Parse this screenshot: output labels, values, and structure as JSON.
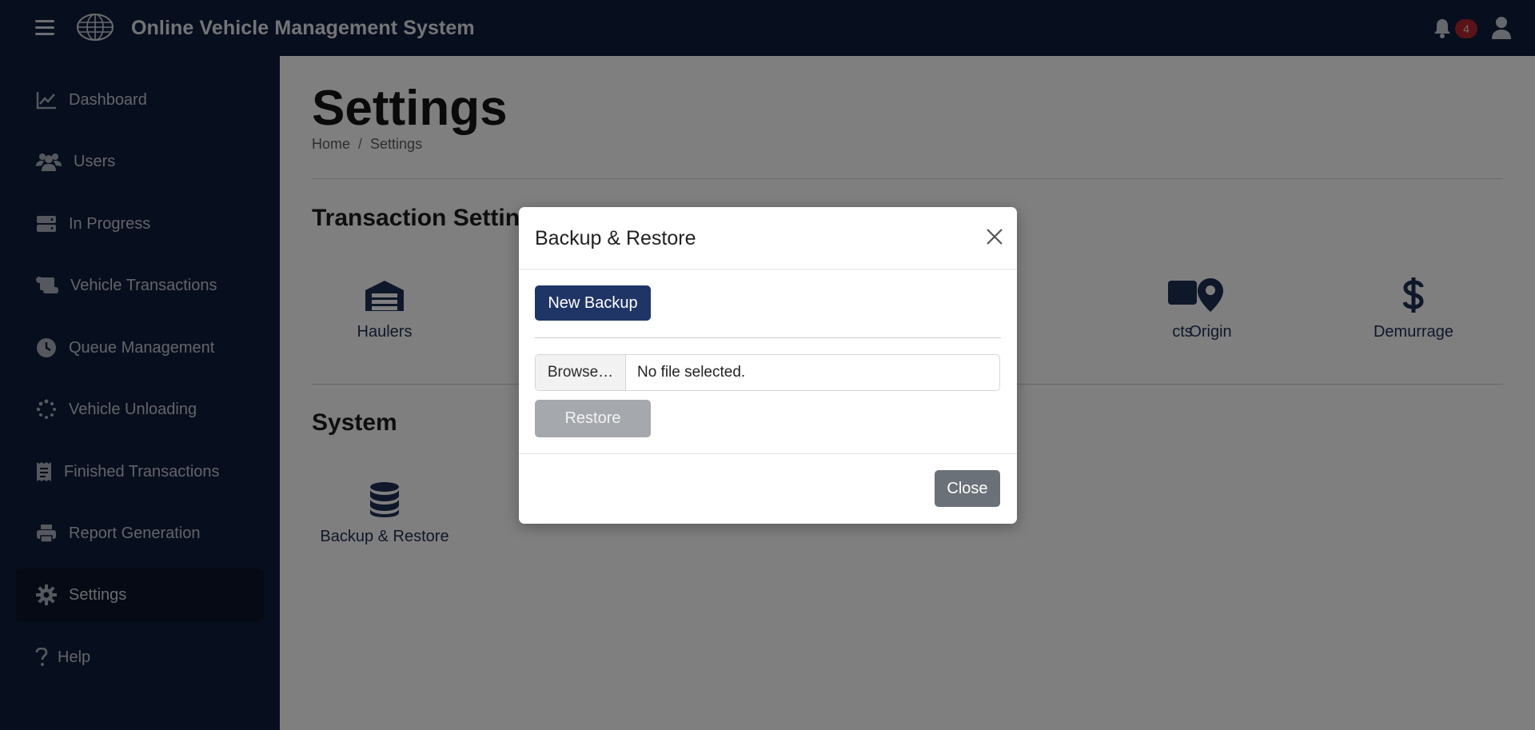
{
  "app": {
    "title": "Online Vehicle Management System",
    "notification_count": "4"
  },
  "sidebar": {
    "items": [
      {
        "label": "Dashboard",
        "icon": "chart-line-icon"
      },
      {
        "label": "Users",
        "icon": "users-icon"
      },
      {
        "label": "In Progress",
        "icon": "server-icon"
      },
      {
        "label": "Vehicle Transactions",
        "icon": "scroll-icon"
      },
      {
        "label": "Queue Management",
        "icon": "clock-icon"
      },
      {
        "label": "Vehicle Unloading",
        "icon": "spinner-icon"
      },
      {
        "label": "Finished Transactions",
        "icon": "receipt-icon"
      },
      {
        "label": "Report Generation",
        "icon": "printer-icon"
      },
      {
        "label": "Settings",
        "icon": "gear-icon",
        "active": true
      },
      {
        "label": "Help",
        "icon": "question-icon"
      }
    ]
  },
  "main": {
    "title": "Settings",
    "breadcrumb": {
      "home": "Home",
      "separator": "/",
      "current": "Settings"
    },
    "transaction_section": {
      "title": "Transaction Settings",
      "tiles": [
        {
          "label": "Haulers",
          "icon": "warehouse-icon"
        },
        {
          "label": "cts",
          "icon": "box-icon"
        },
        {
          "label": "Origin",
          "icon": "map-pin-icon"
        },
        {
          "label": "Demurrage",
          "icon": "dollar-icon"
        }
      ]
    },
    "system_section": {
      "title": "System",
      "tiles": [
        {
          "label": "Backup & Restore",
          "icon": "database-icon"
        }
      ]
    }
  },
  "modal": {
    "title": "Backup & Restore",
    "new_backup_label": "New Backup",
    "file_browse_label": "Browse…",
    "file_status": "No file selected.",
    "restore_label": "Restore",
    "close_label": "Close"
  },
  "colors": {
    "sidebar_bg": "#0f1c3a",
    "primary": "#1f3566",
    "tile_icon": "#1e2e55",
    "badge": "#b3262e",
    "secondary_button": "#6b7178"
  }
}
